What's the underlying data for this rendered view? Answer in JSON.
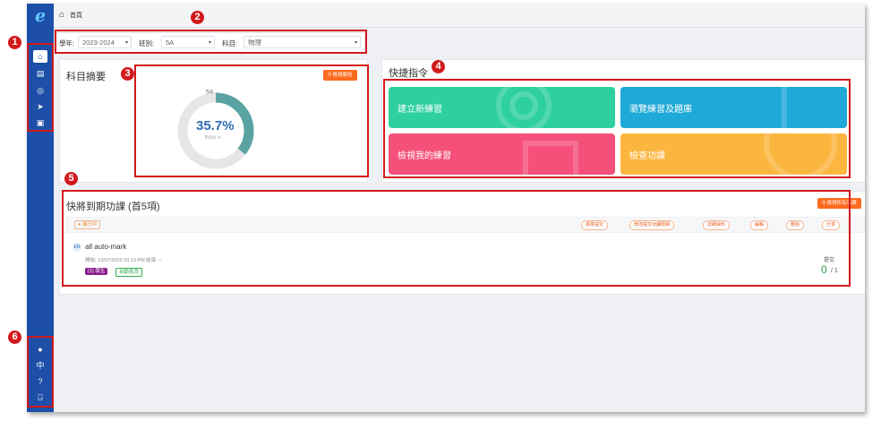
{
  "breadcrumb": {
    "label": "首頁"
  },
  "filters": {
    "year_label": "學年:",
    "year_value": "2023-2024",
    "class_label": "班別:",
    "class_value": "5A",
    "subject_label": "科目:",
    "subject_value": "物理"
  },
  "summary": {
    "title": "科目摘要",
    "report_button": "檢視報告",
    "class_name": "5A",
    "percent": "35.7%",
    "percent_fraction": 0.357,
    "caption": "平均分 %"
  },
  "quick": {
    "title": "快捷指令",
    "tiles": [
      {
        "label": "建立新練習",
        "color": "#2fd0a0"
      },
      {
        "label": "瀏覽練習及題庫",
        "color": "#1fa9d8"
      },
      {
        "label": "檢視我的練習",
        "color": "#f4507a"
      },
      {
        "label": "檢查功課",
        "color": "#fbb640"
      }
    ]
  },
  "due": {
    "title": "快將到期功課 (首5項)",
    "all_button": "檢視所有功課",
    "status": "進行中",
    "actions": [
      "標準提交",
      "修改提交功課限期",
      "詳細資料",
      "編輯",
      "刪除",
      "分享"
    ],
    "item": {
      "lang": "EN",
      "name": "all auto-mark",
      "meta": "開始: 13/07/2023 03:13 PM  結束: --",
      "tag1": "(1) 學生",
      "tag2": "自動批改",
      "submit_label": "提交",
      "submit_done": "0",
      "submit_total": "/ 1"
    }
  },
  "markers": [
    "1",
    "2",
    "3",
    "4",
    "5",
    "6"
  ],
  "colors": {
    "sidebar": "#1d4fa8",
    "accent": "#ff6b1f",
    "annotation": "#d2191c",
    "gauge": "#5aa3a3"
  }
}
